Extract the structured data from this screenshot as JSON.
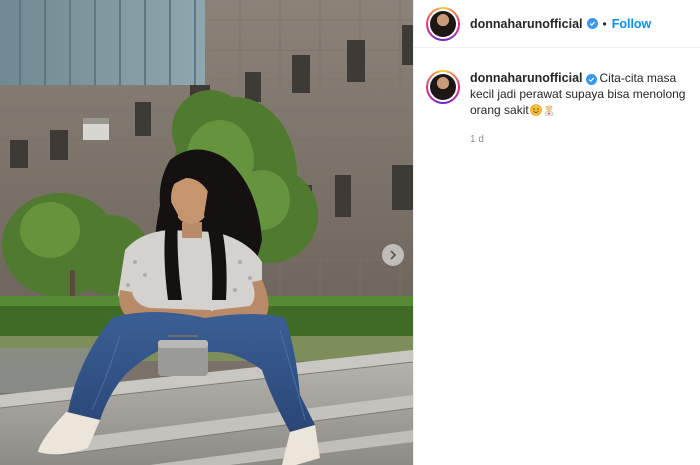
{
  "post": {
    "author": {
      "username": "donnaharunofficial",
      "verified": true
    },
    "header": {
      "separator": "•",
      "follow_label": "Follow"
    },
    "caption": {
      "text": "Cita-cita masa kecil jadi perawat supaya bisa menolong orang sakit",
      "emojis": [
        "smiling-face-emoji",
        "health-worker-emoji"
      ]
    },
    "timestamp": "1 d",
    "media": {
      "carousel_next_icon": "chevron-right-icon"
    }
  },
  "colors": {
    "accent": "#0095f6",
    "verified_badge": "#3897f0",
    "secondary_text": "#8e8e8e",
    "divider": "#efefef"
  }
}
